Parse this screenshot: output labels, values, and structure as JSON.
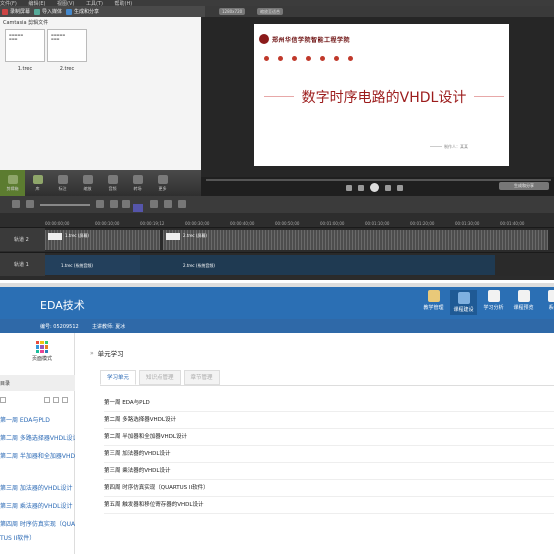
{
  "camtasia": {
    "menu": [
      "文件(F)",
      "编辑(E)",
      "视图(V)",
      "工具(T)",
      "帮助(H)"
    ],
    "toolbar": {
      "record": "录制屏幕",
      "import": "导入媒体",
      "produce": "生成和分享"
    },
    "clip_bin_title": "Camtasia 剪辑文件",
    "clips": [
      "1.trec",
      "2.trec"
    ],
    "preview_pills": [
      "1280x720",
      "缩放至适合"
    ],
    "slide": {
      "school": "郑州华信学院智能工程学院",
      "title": "数字时序电路的VHDL设计",
      "author": "制作人：某某"
    },
    "tasks": [
      "剪辑箱",
      "库",
      "标注",
      "缩放",
      "音频",
      "转场",
      "更多"
    ],
    "produce_button": "生成和分享",
    "ruler_ticks": [
      "00:00:00;00",
      "00:00:10;00",
      "00:00:19;12",
      "00:00:30;00",
      "00:00:40;00",
      "00:00:50;00",
      "00:01:00;00",
      "00:01:10;00",
      "00:01:20;00",
      "00:01:30;00",
      "00:01:40;00"
    ],
    "tracks": [
      {
        "label": "轨道 2",
        "clips": [
          "1.trec (屏幕)",
          "2.trec (屏幕)"
        ]
      },
      {
        "label": "轨道 1",
        "clips": [
          "1.trec (系统音频)",
          "2.trec (系统音频)"
        ]
      }
    ]
  },
  "portal": {
    "course_title": "EDA技术",
    "course_code": "编号: 05209512",
    "teacher": "主讲教师: 夏冰",
    "nav": [
      {
        "label": "教学管理",
        "icon": "briefcase-icon"
      },
      {
        "label": "课程建设",
        "icon": "chart-icon"
      },
      {
        "label": "学习分析",
        "icon": "book-icon"
      },
      {
        "label": "课程预览",
        "icon": "send-icon"
      },
      {
        "label": "系统",
        "icon": "gear-icon"
      }
    ],
    "layout_button": "页面模式",
    "sidebar_head": "目录",
    "sidebar_items": [
      "第一周 EDA与PLD",
      "第二周 多路选择器VHDL设计",
      "第二周 半加器和全加器VHDL",
      "第三周 加法器的VHDL设计",
      "第三周 乘法器的VHDL设计",
      "第四周 时序仿真实现（QUAR",
      "TUS II软件）"
    ],
    "breadcrumb": "单元学习",
    "tabs": [
      "学习单元",
      "知识点管理",
      "章节管理"
    ],
    "units": [
      "第一周 EDA与PLD",
      "第二周 多路选择器VHDL设计",
      "第二周 半加器和全加器VHDL设计",
      "第三周 加法器的VHDL设计",
      "第三周 乘法器的VHDL设计",
      "第四周 时序仿真实现（QUARTUS II软件）",
      "第五周 触发器和移位寄存器的VHDL设计"
    ]
  }
}
